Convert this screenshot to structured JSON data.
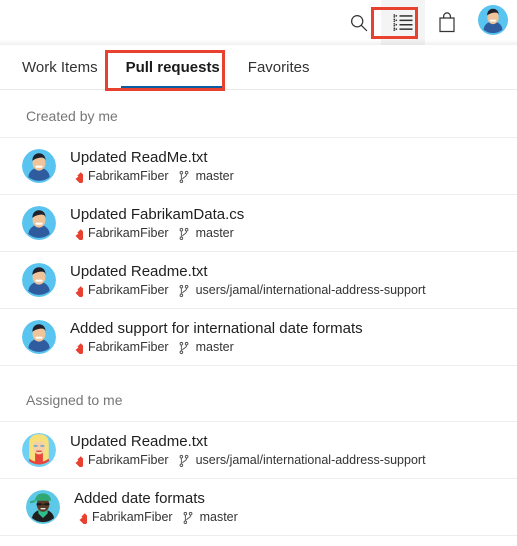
{
  "header": {
    "icons": [
      {
        "name": "search-icon",
        "label": "Search"
      },
      {
        "name": "queue-list-icon",
        "label": "My work"
      },
      {
        "name": "shopping-bag-icon",
        "label": "Marketplace"
      },
      {
        "name": "user-avatar-icon",
        "label": "User profile"
      }
    ]
  },
  "tabs": [
    {
      "label": "Work Items",
      "active": false
    },
    {
      "label": "Pull requests",
      "active": true
    },
    {
      "label": "Favorites",
      "active": false
    }
  ],
  "sections": [
    {
      "title": "Created by me",
      "items": [
        {
          "title": "Updated ReadMe.txt",
          "repo": "FabrikamFiber",
          "branch": "master",
          "avatar": "man-dark-hair",
          "indented": false
        },
        {
          "title": "Updated FabrikamData.cs",
          "repo": "FabrikamFiber",
          "branch": "master",
          "avatar": "man-dark-hair",
          "indented": false
        },
        {
          "title": "Updated Readme.txt",
          "repo": "FabrikamFiber",
          "branch": "users/jamal/international-address-support",
          "avatar": "man-dark-hair",
          "indented": false
        },
        {
          "title": "Added support for international date formats",
          "repo": "FabrikamFiber",
          "branch": "master",
          "avatar": "man-dark-hair",
          "indented": false
        }
      ]
    },
    {
      "title": "Assigned to me",
      "items": [
        {
          "title": "Updated Readme.txt",
          "repo": "FabrikamFiber",
          "branch": "users/jamal/international-address-support",
          "avatar": "woman-blonde",
          "indented": false
        },
        {
          "title": "Added date formats",
          "repo": "FabrikamFiber",
          "branch": "master",
          "avatar": "person-green-cap",
          "indented": true
        }
      ]
    }
  ],
  "colors": {
    "accent_tab_underline": "#0b5ca3",
    "annotation_red": "#e8412f",
    "repo_icon_red": "#e8412f",
    "section_header_gray": "#767676",
    "title_text": "#1f1f1f",
    "divider": "#ededed"
  },
  "annotations": [
    {
      "name": "queue-icon-highlight",
      "target": "queue-list-icon"
    },
    {
      "name": "pull-requests-tab-highlight",
      "target": "tab-pull-requests"
    }
  ]
}
